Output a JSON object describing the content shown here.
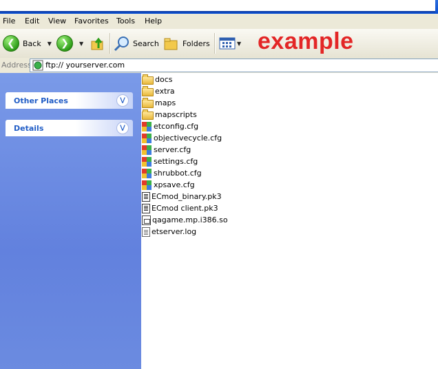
{
  "menu": [
    "File",
    "Edit",
    "View",
    "Favorites",
    "Tools",
    "Help"
  ],
  "toolbar": {
    "back_label": "Back",
    "search_label": "Search",
    "folders_label": "Folders"
  },
  "overlay_text": "example",
  "address": {
    "label": "Address",
    "value": "ftp:// yourserver.com"
  },
  "left_panels": [
    {
      "title": "Other Places"
    },
    {
      "title": "Details"
    }
  ],
  "files": [
    {
      "name": "docs",
      "type": "folder"
    },
    {
      "name": "extra",
      "type": "folder"
    },
    {
      "name": "maps",
      "type": "folder"
    },
    {
      "name": "mapscripts",
      "type": "folder"
    },
    {
      "name": "etconfig.cfg",
      "type": "cfg"
    },
    {
      "name": "objectivecycle.cfg",
      "type": "cfg"
    },
    {
      "name": "server.cfg",
      "type": "cfg"
    },
    {
      "name": "settings.cfg",
      "type": "cfg"
    },
    {
      "name": "shrubbot.cfg",
      "type": "cfg"
    },
    {
      "name": "xpsave.cfg",
      "type": "cfg"
    },
    {
      "name": "ECmod_binary.pk3",
      "type": "pk3"
    },
    {
      "name": "ECmod client.pk3",
      "type": "pk3"
    },
    {
      "name": "qagame.mp.i386.so",
      "type": "so"
    },
    {
      "name": "etserver.log",
      "type": "log"
    }
  ]
}
